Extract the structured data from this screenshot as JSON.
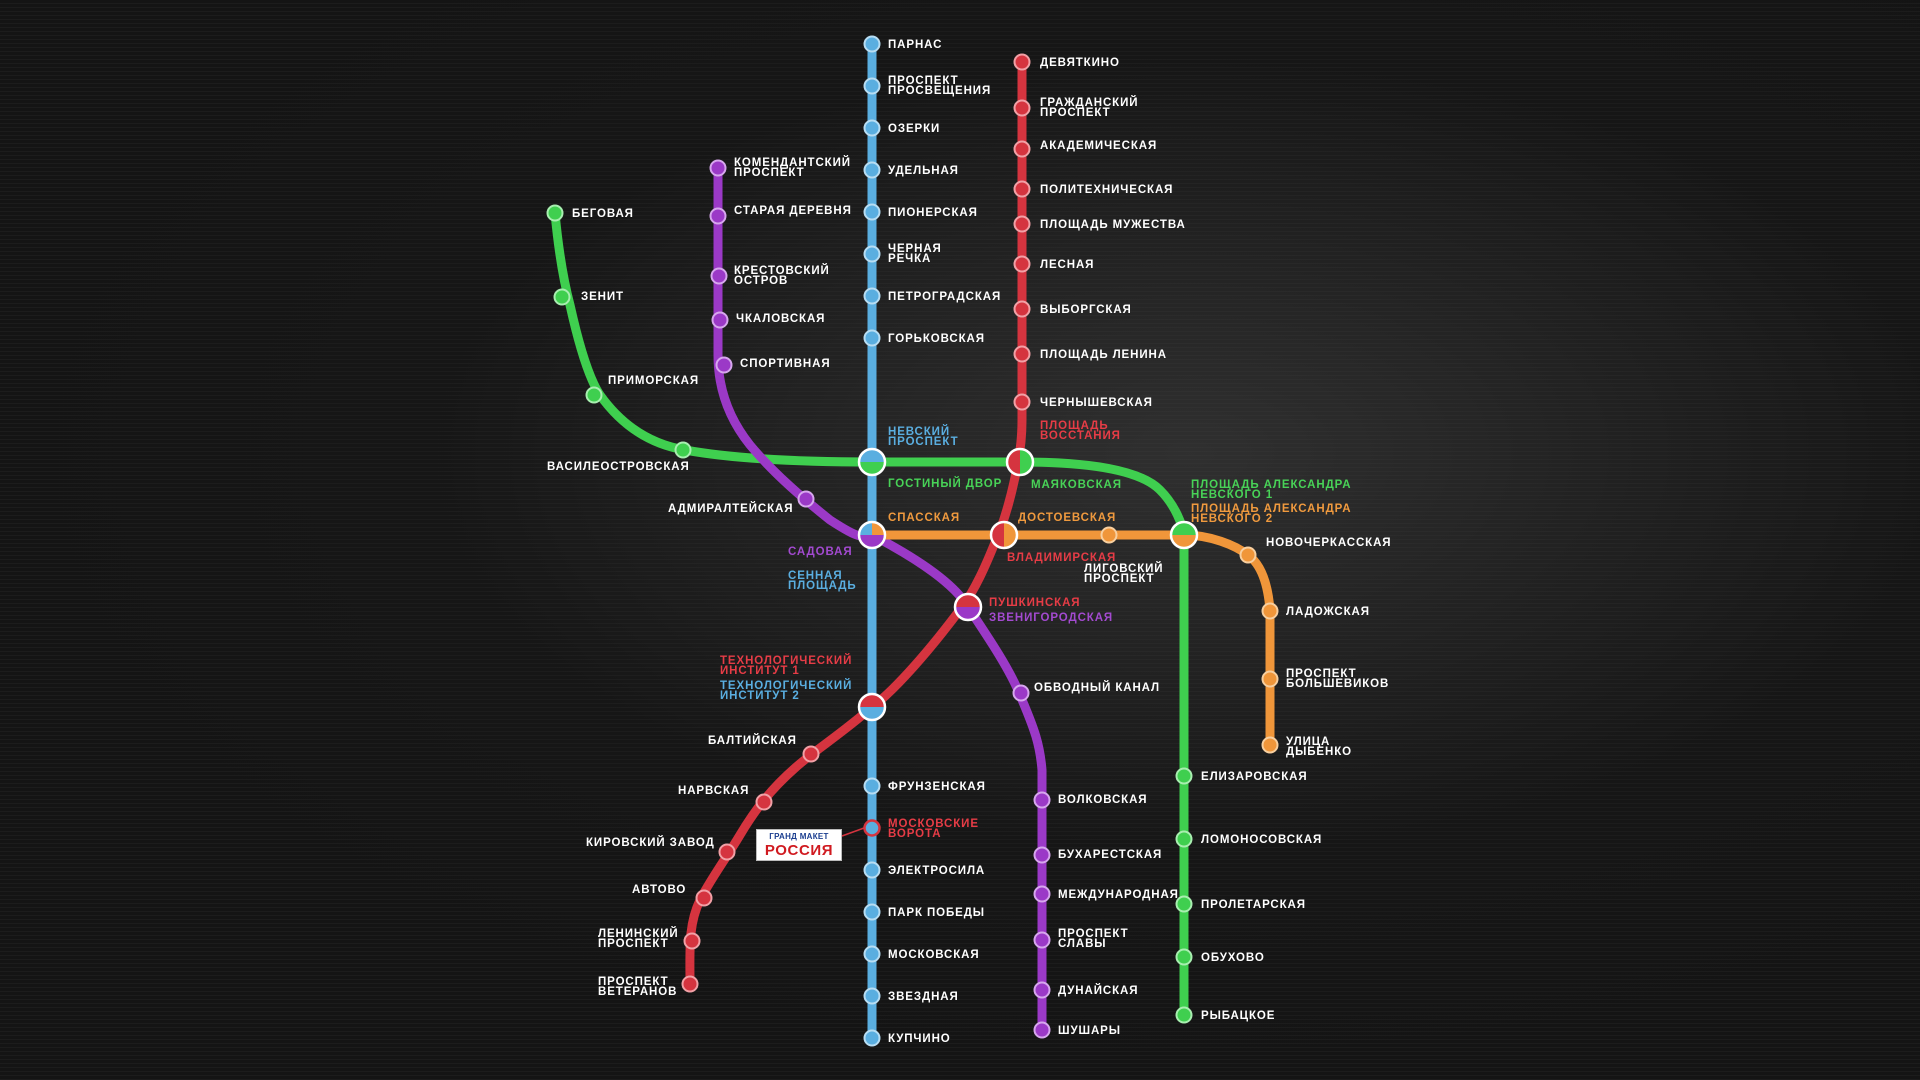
{
  "colors": {
    "line_blue": "#5aaee0",
    "line_red": "#d5343f",
    "line_green": "#3fcf4f",
    "line_purple": "#9b39c7",
    "line_orange": "#f0963a",
    "label_white": "#ffffff",
    "label_blue": "#5aaee0",
    "label_red": "#e63c46",
    "label_green": "#48d257",
    "label_purple": "#a34ad0",
    "label_orange": "#f09a3e"
  },
  "logo": {
    "top_text": "ГРАНД МАКЕТ",
    "bottom_text": "РОССИЯ"
  },
  "stations": {
    "blue": {
      "parnas": "ПАРНАС",
      "prosp_prosv_1": "ПРОСПЕКТ",
      "prosp_prosv_2": "ПРОСВЕЩЕНИЯ",
      "ozerki": "ОЗЕРКИ",
      "udelnaya": "УДЕЛЬНАЯ",
      "pionerskaya": "ПИОНЕРСКАЯ",
      "chernaya_1": "ЧЕРНАЯ",
      "chernaya_2": "РЕЧКА",
      "petrogradskaya": "ПЕТРОГРАДСКАЯ",
      "gorkovskaya": "ГОРЬКОВСКАЯ",
      "nevsky_1": "НЕВСКИЙ",
      "nevsky_2": "ПРОСПЕКТ",
      "sennaya_1": "СЕННАЯ",
      "sennaya_2": "ПЛОЩАДЬ",
      "tech2_1": "ТЕХНОЛОГИЧЕСКИЙ",
      "tech2_2": "ИНСТИТУТ 2",
      "frunzenskaya": "ФРУНЗЕНСКАЯ",
      "mosk_vorota_1": "МОСКОВСКИЕ",
      "mosk_vorota_2": "ВОРОТА",
      "elektrosila": "ЭЛЕКТРОСИЛА",
      "park_pobedy": "ПАРК ПОБЕДЫ",
      "moskovskaya": "МОСКОВСКАЯ",
      "zvezdnaya": "ЗВЕЗДНАЯ",
      "kupchino": "КУПЧИНО"
    },
    "red": {
      "devyatkino": "ДЕВЯТКИНО",
      "grazhd_1": "ГРАЖДАНСКИЙ",
      "grazhd_2": "ПРОСПЕКТ",
      "akademicheskaya": "АКАДЕМИЧЕСКАЯ",
      "politekhnicheskaya": "ПОЛИТЕХНИЧЕСКАЯ",
      "pl_muzhestva": "ПЛОЩАДЬ МУЖЕСТВА",
      "lesnaya": "ЛЕСНАЯ",
      "vyborgskaya": "ВЫБОРГСКАЯ",
      "pl_lenina": "ПЛОЩАДЬ ЛЕНИНА",
      "chernyshevskaya": "ЧЕРНЫШЕВСКАЯ",
      "pl_vosst_1": "ПЛОЩАДЬ",
      "pl_vosst_2": "ВОССТАНИЯ",
      "vladimirskaya": "ВЛАДИМИРСКАЯ",
      "pushkinskaya": "ПУШКИНСКАЯ",
      "tech1_1": "ТЕХНОЛОГИЧЕСКИЙ",
      "tech1_2": "ИНСТИТУТ 1",
      "baltiyskaya": "БАЛТИЙСКАЯ",
      "narvskaya": "НАРВСКАЯ",
      "kirovsky": "КИРОВСКИЙ ЗАВОД",
      "avtovo": "АВТОВО",
      "leninsky_1": "ЛЕНИНСКИЙ",
      "leninsky_2": "ПРОСПЕКТ",
      "veteranov_1": "ПРОСПЕКТ",
      "veteranov_2": "ВЕТЕРАНОВ"
    },
    "green": {
      "begovaya": "БЕГОВАЯ",
      "zenit": "ЗЕНИТ",
      "primorskaya": "ПРИМОРСКАЯ",
      "vasileostrovskaya": "ВАСИЛЕОСТРОВСКАЯ",
      "gostiny": "ГОСТИНЫЙ ДВОР",
      "mayakovskaya": "МАЯКОВСКАЯ",
      "pan1_1": "ПЛОЩАДЬ АЛЕКСАНДРА",
      "pan1_2": "НЕВСКОГО 1",
      "elizarovskaya": "ЕЛИЗАРОВСКАЯ",
      "lomonosovskaya": "ЛОМОНОСОВСКАЯ",
      "proletarskaya": "ПРОЛЕТАРСКАЯ",
      "obukhovo": "ОБУХОВО",
      "rybatskoe": "РЫБАЦКОЕ"
    },
    "purple": {
      "komend_1": "КОМЕНДАНТСКИЙ",
      "komend_2": "ПРОСПЕКТ",
      "staraya": "СТАРАЯ ДЕРЕВНЯ",
      "krestovsky_1": "КРЕСТОВСКИЙ",
      "krestovsky_2": "ОСТРОВ",
      "chkalovskaya": "ЧКАЛОВСКАЯ",
      "sportivnaya": "СПОРТИВНАЯ",
      "admiralteyskaya": "АДМИРАЛТЕЙСКАЯ",
      "sadovaya": "САДОВАЯ",
      "zvenigorodskaya": "ЗВЕНИГОРОДСКАЯ",
      "obvodny": "ОБВОДНЫЙ КАНАЛ",
      "volkovskaya": "ВОЛКОВСКАЯ",
      "bukharestskaya": "БУХАРЕСТСКАЯ",
      "mezhdunarodnaya": "МЕЖДУНАРОДНАЯ",
      "pr_slavy_1": "ПРОСПЕКТ",
      "pr_slavy_2": "СЛАВЫ",
      "dunayskaya": "ДУНАЙСКАЯ",
      "shushary": "ШУШАРЫ"
    },
    "orange": {
      "spasskaya": "СПАССКАЯ",
      "dostoevskaya": "ДОСТОЕВСКАЯ",
      "ligovsky_1": "ЛИГОВСКИЙ",
      "ligovsky_2": "ПРОСПЕКТ",
      "pan2_1": "ПЛОЩАДЬ АЛЕКСАНДРА",
      "pan2_2": "НЕВСКОГО 2",
      "novocherkasskaya": "НОВОЧЕРКАССКАЯ",
      "ladozhskaya": "ЛАДОЖСКАЯ",
      "pr_bolsh_1": "ПРОСПЕКТ",
      "pr_bolsh_2": "БОЛЬШЕВИКОВ",
      "dybenko_1": "УЛИЦА",
      "dybenko_2": "ДЫБЕНКО"
    }
  }
}
